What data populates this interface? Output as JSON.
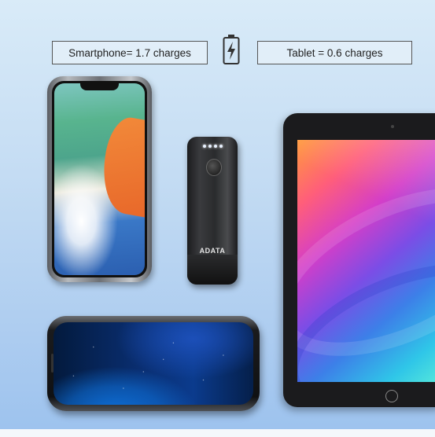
{
  "labels": {
    "smartphone": "Smartphone= 1.7 charges",
    "tablet": "Tablet = 0.6 charges"
  },
  "powerbank": {
    "brand": "ADATA"
  },
  "icons": {
    "battery": "battery-charging-icon"
  }
}
